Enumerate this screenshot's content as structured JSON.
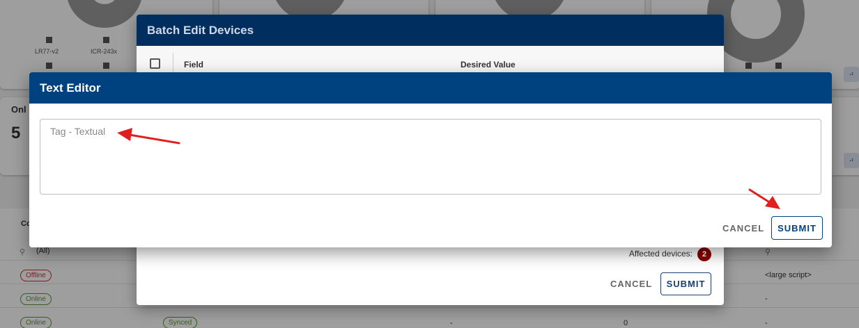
{
  "background": {
    "chart_labels": [
      "LR77-v2",
      "ICR-243x"
    ],
    "stat_label": "Onl",
    "stat_value": "5",
    "table_header_fragment": "Co",
    "filter_value": "(All)",
    "rows": [
      {
        "status": "Offline",
        "status_kind": "offline",
        "col_right": "<large script>"
      },
      {
        "status": "Online",
        "status_kind": "online",
        "col_right": "-"
      },
      {
        "status": "Online",
        "status_kind": "online",
        "sync": "Synced",
        "col_mid": "-",
        "col_num": "0",
        "col_right": "-"
      }
    ]
  },
  "batch_dialog": {
    "title": "Batch Edit Devices",
    "columns": {
      "field": "Field",
      "desired_value": "Desired Value"
    },
    "affected_label": "Affected devices:",
    "affected_count": "2",
    "cancel_label": "CANCEL",
    "submit_label": "SUBMIT"
  },
  "text_editor": {
    "title": "Text Editor",
    "textarea": {
      "value": "",
      "placeholder": "Tag - Textual"
    },
    "cancel_label": "CANCEL",
    "submit_label": "SUBMIT"
  },
  "colors": {
    "editor_header": "#00427f",
    "batch_header": "#002e5e",
    "annotation_arrow": "#e02020",
    "badge": "#8b0000"
  }
}
